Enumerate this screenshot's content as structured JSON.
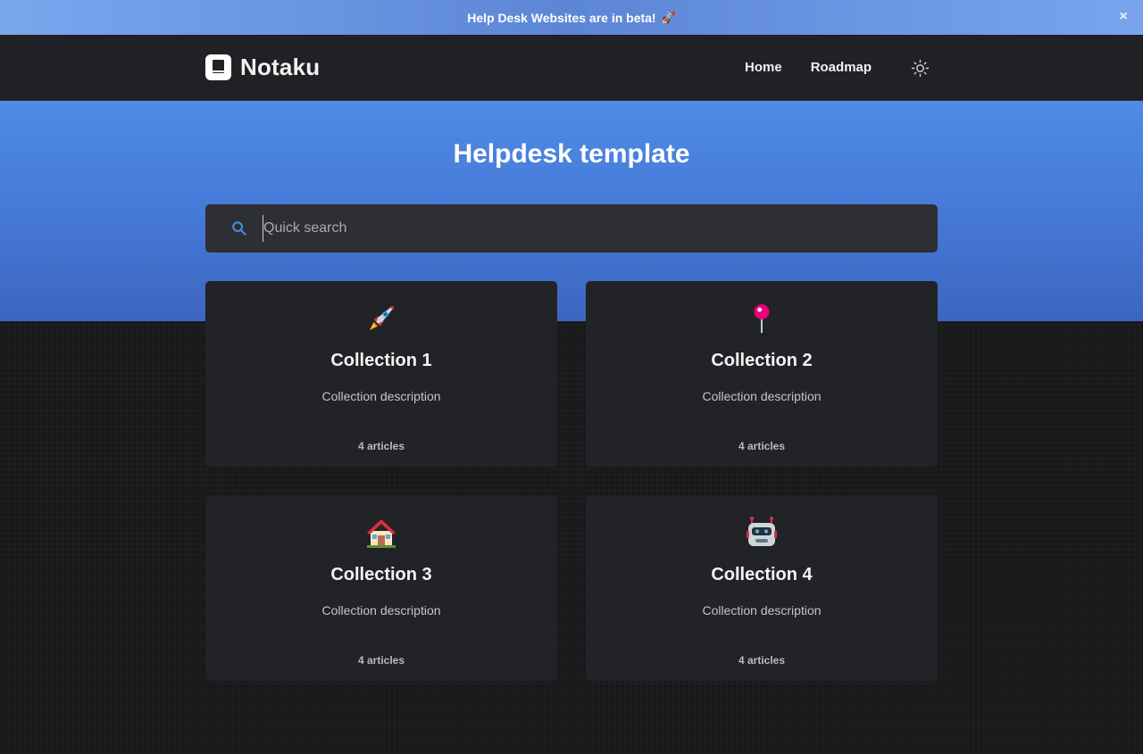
{
  "banner": {
    "text": "Help Desk Websites are in beta!",
    "emoji": "🚀",
    "close_icon": "close-icon"
  },
  "header": {
    "logo_text": "Notaku",
    "logo_icon": "book-icon",
    "nav": [
      {
        "label": "Home"
      },
      {
        "label": "Roadmap"
      }
    ],
    "theme_icon": "sun-icon"
  },
  "hero": {
    "title": "Helpdesk template",
    "search_placeholder": "Quick search",
    "search_icon": "search-icon",
    "accent_color": "#4f8be6"
  },
  "collections": [
    {
      "title": "Collection 1",
      "description": "Collection description",
      "count": "4 articles",
      "icon": "rocket-icon"
    },
    {
      "title": "Collection 2",
      "description": "Collection description",
      "count": "4 articles",
      "icon": "pushpin-icon"
    },
    {
      "title": "Collection 3",
      "description": "Collection description",
      "count": "4 articles",
      "icon": "house-icon"
    },
    {
      "title": "Collection 4",
      "description": "Collection description",
      "count": "4 articles",
      "icon": "robot-icon"
    }
  ]
}
